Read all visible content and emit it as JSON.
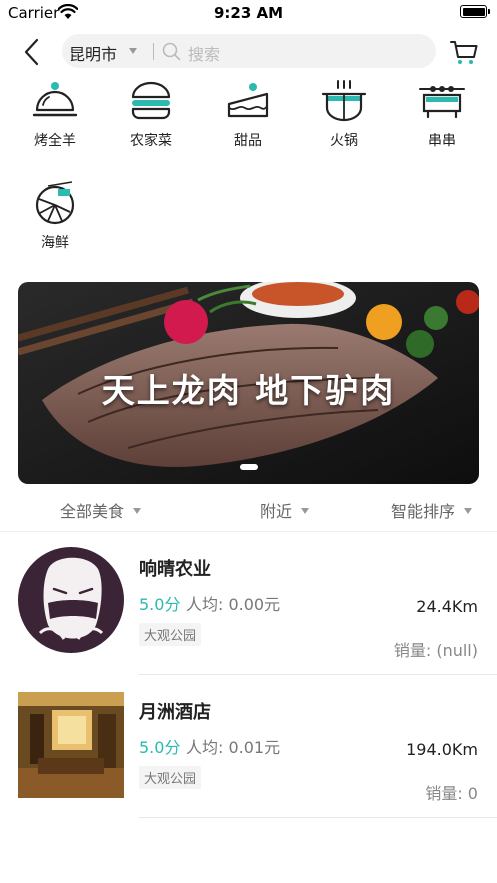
{
  "status_bar": {
    "carrier": "Carrier",
    "time": "9:23 AM"
  },
  "nav": {
    "city": "昆明市",
    "search_placeholder": "搜索"
  },
  "categories": [
    {
      "label": "烤全羊",
      "icon": "cloche-icon"
    },
    {
      "label": "农家菜",
      "icon": "burger-icon"
    },
    {
      "label": "甜品",
      "icon": "cake-icon"
    },
    {
      "label": "火锅",
      "icon": "hotpot-icon"
    },
    {
      "label": "串串",
      "icon": "skewer-icon"
    },
    {
      "label": "海鲜",
      "icon": "shrimp-icon"
    }
  ],
  "banner": {
    "text": "天上龙肉 地下驴肉"
  },
  "filters": {
    "all_food": "全部美食",
    "nearby": "附近",
    "smart_sort": "智能排序"
  },
  "shops": [
    {
      "name": "响晴农业",
      "rating": "5.0分",
      "avg": "人均: 0.00元",
      "tag": "大观公园",
      "distance": "24.4Km",
      "sales": "销量: (null)"
    },
    {
      "name": "月洲酒店",
      "rating": "5.0分",
      "avg": "人均: 0.01元",
      "tag": "大观公园",
      "distance": "194.0Km",
      "sales": "销量: 0"
    }
  ],
  "colors": {
    "accent": "#2bbab0",
    "icon_stroke": "#222222"
  }
}
